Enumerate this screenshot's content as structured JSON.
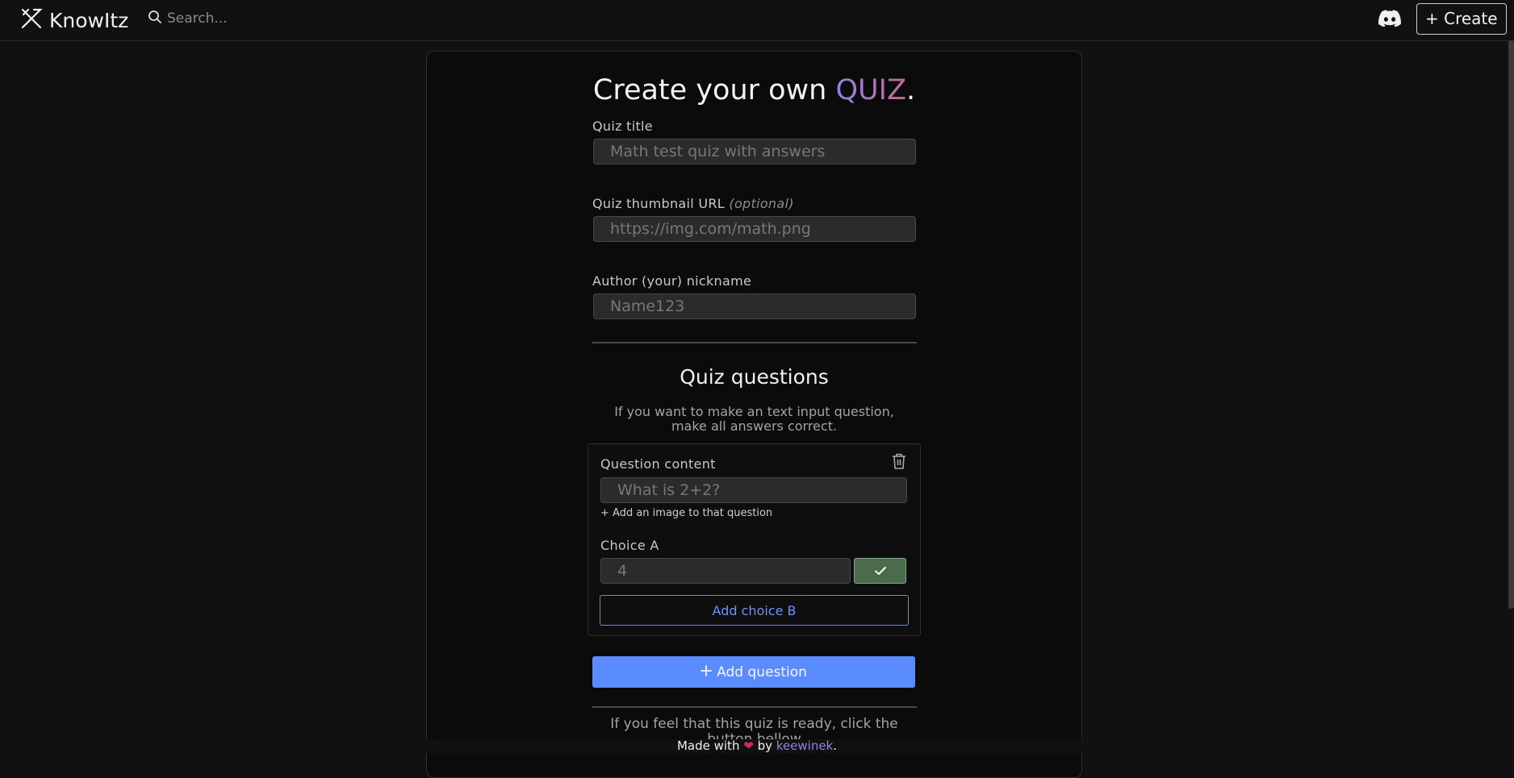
{
  "app": {
    "name": "KnowItz"
  },
  "header": {
    "search_placeholder": "Search...",
    "create_label": "+ Create"
  },
  "page": {
    "title_prefix": "Create your own ",
    "title_highlight": "QUIZ",
    "title_suffix": "."
  },
  "form": {
    "quiz_title": {
      "label": "Quiz title",
      "placeholder": "Math test quiz with answers",
      "value": ""
    },
    "thumbnail": {
      "label": "Quiz thumbnail URL",
      "optional": "(optional)",
      "placeholder": "https://img.com/math.png",
      "value": ""
    },
    "author": {
      "label": "Author (your) nickname",
      "placeholder": "Name123",
      "value": ""
    }
  },
  "questions_section": {
    "title": "Quiz questions",
    "hint_line1": "If you want to make an text input question,",
    "hint_line2": "make all answers correct.",
    "question": {
      "content_label": "Question content",
      "content_placeholder": "What is 2+2?",
      "add_image": "+ Add an image to that question",
      "choice_label": "Choice A",
      "choice_placeholder": "4",
      "add_choice": "Add choice B"
    },
    "add_question": "Add question"
  },
  "ready_hint": "If you feel that this quiz is ready, click the button bellow",
  "footer": {
    "prefix": "Made with",
    "by": "by",
    "author": "keewinek",
    "suffix": "."
  },
  "colors": {
    "accent_blue": "#5b8cff",
    "correct_green": "#4c6b4c",
    "heart": "#e0245e"
  }
}
